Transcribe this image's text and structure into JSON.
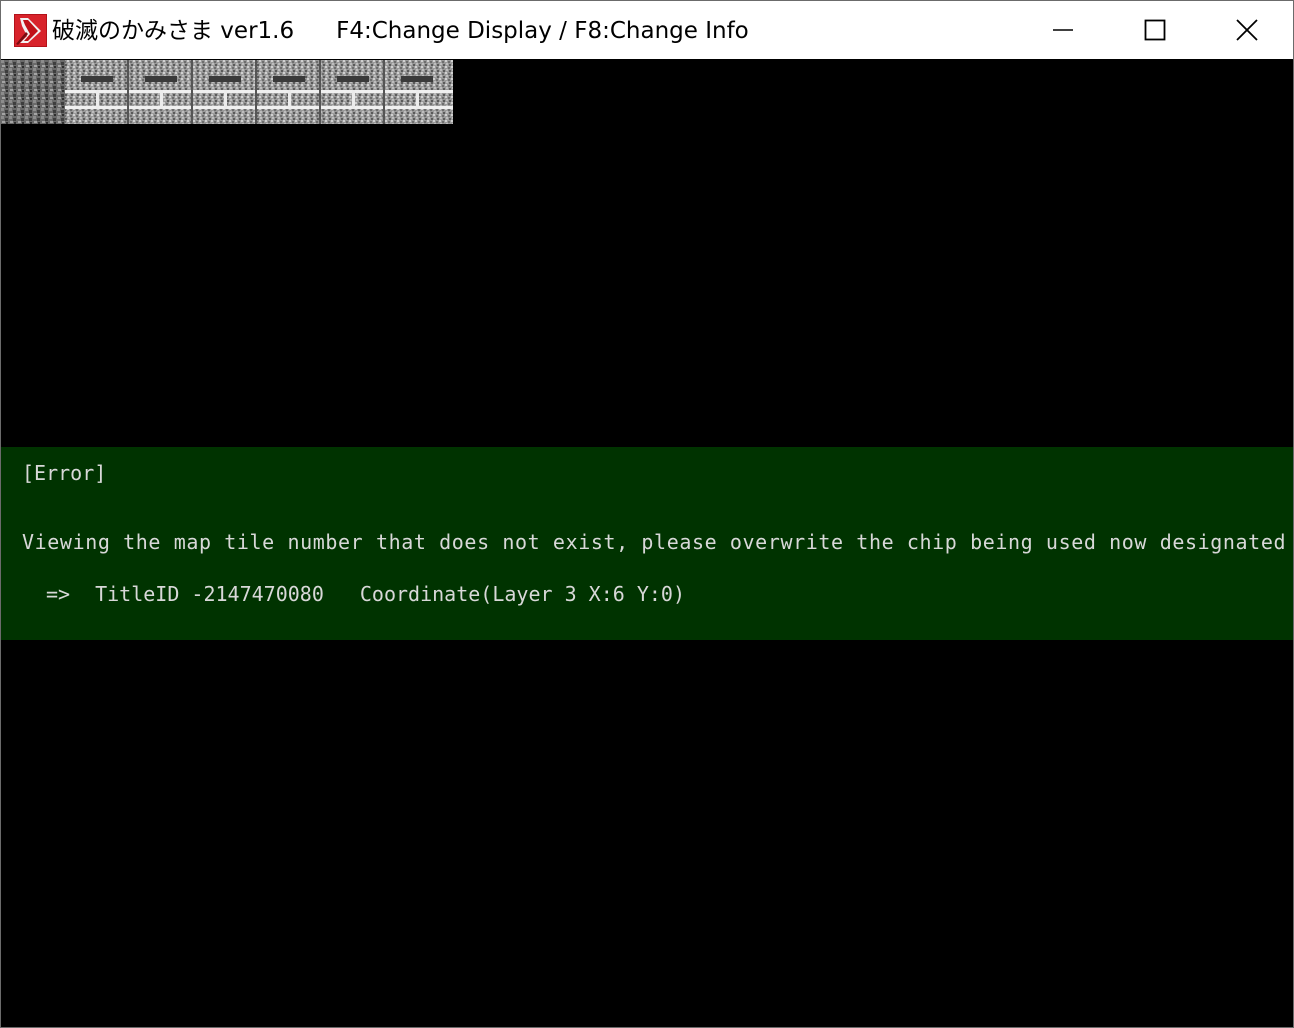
{
  "window": {
    "title": "破滅のかみさま ver1.6",
    "hint": "F4:Change Display / F8:Change Info",
    "icon": "app-logo-icon",
    "controls": [
      "minimize-icon",
      "maximize-icon",
      "close-icon"
    ]
  },
  "game": {
    "background": "#000000",
    "tile_strip": {
      "tile_count": 7,
      "description_icons": [
        "rock-tile-icon",
        "stone-brick-tile-icon"
      ]
    }
  },
  "error": {
    "background": "#003300",
    "heading": "[Error]",
    "message": "Viewing the map tile number that does not exist, please overwrite the chip being used now designated plac",
    "arrow": "=>",
    "tile_id": "TitleID -2147470080",
    "coordinate": "Coordinate(Layer 3 X:6 Y:0)"
  }
}
